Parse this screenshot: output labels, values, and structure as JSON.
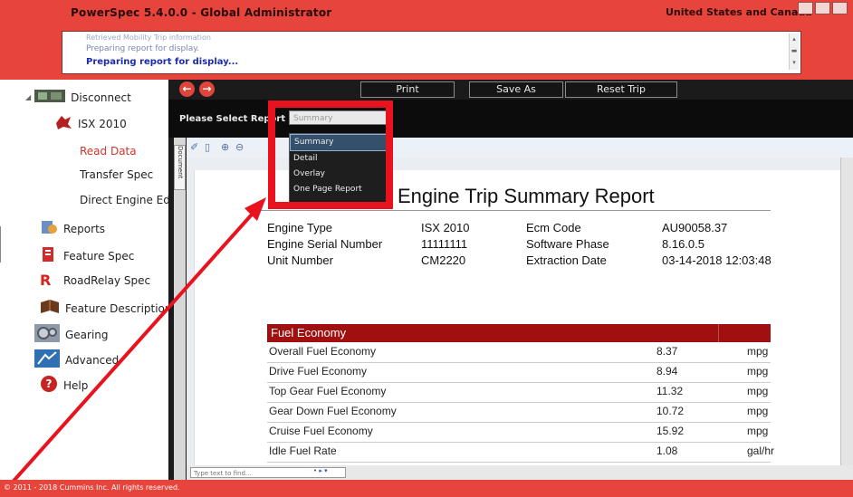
{
  "window": {
    "title": "PowerSpec 5.4.0.0 - Global Administrator",
    "region": "United States and Canada"
  },
  "messages": {
    "line1": "Retrieved Mobility Trip information",
    "line2": "Preparing report for display.",
    "line3": "Preparing report for display..."
  },
  "sidebar": {
    "connect_label": "Disconnect",
    "engine_label": "ISX 2010",
    "sub_items": [
      {
        "label": "Read Data",
        "active": true
      },
      {
        "label": "Transfer Spec",
        "active": false
      },
      {
        "label": "Direct Engine Edit",
        "active": false
      }
    ],
    "items": [
      {
        "label": "Reports",
        "icon": "reports-icon"
      },
      {
        "label": "Feature Spec",
        "icon": "feature-spec-icon"
      },
      {
        "label": "RoadRelay Spec",
        "icon": "roadrelay-icon"
      },
      {
        "label": "Feature Description",
        "icon": "book-icon"
      },
      {
        "label": "Gearing",
        "icon": "gearing-icon"
      },
      {
        "label": "Advanced",
        "icon": "advanced-icon"
      },
      {
        "label": "Help",
        "icon": "help-icon"
      }
    ]
  },
  "toolbar": {
    "print_label": "Print",
    "saveas_label": "Save As",
    "reset_label": "Reset Trip"
  },
  "report_select": {
    "label": "Please Select Report",
    "value": "Summary",
    "options": [
      "Summary",
      "Detail",
      "Overlay",
      "One Page Report"
    ]
  },
  "side_tab_label": "Document",
  "report": {
    "title": "Engine Trip Summary Report",
    "info_left": [
      {
        "label": "Engine Type",
        "value": "ISX 2010"
      },
      {
        "label": "Engine Serial Number",
        "value": "11111111"
      },
      {
        "label": "Unit Number",
        "value": "CM2220"
      }
    ],
    "info_right": [
      {
        "label": "Ecm Code",
        "value": "AU90058.37"
      },
      {
        "label": "Software Phase",
        "value": "8.16.0.5"
      },
      {
        "label": "Extraction Date",
        "value": "03-14-2018 12:03:48"
      }
    ],
    "fuel_section_title": "Fuel Economy",
    "fuel_rows": [
      {
        "name": "Overall Fuel Economy",
        "value": "8.37",
        "unit": "mpg"
      },
      {
        "name": "Drive Fuel Economy",
        "value": "8.94",
        "unit": "mpg"
      },
      {
        "name": "Top Gear Fuel Economy",
        "value": "11.32",
        "unit": "mpg"
      },
      {
        "name": "Gear Down Fuel Economy",
        "value": "10.72",
        "unit": "mpg"
      },
      {
        "name": "Cruise Fuel Economy",
        "value": "15.92",
        "unit": "mpg"
      },
      {
        "name": "Idle Fuel Rate",
        "value": "1.08",
        "unit": "gal/hr"
      }
    ]
  },
  "find": {
    "placeholder": "Type text to find..."
  },
  "footer": {
    "copyright": "© 2011 - 2018 Cummins Inc. All rights reserved."
  },
  "colors": {
    "brand_red": "#e7443c",
    "highlight_red": "#e8131f",
    "section_red": "#a01010"
  }
}
